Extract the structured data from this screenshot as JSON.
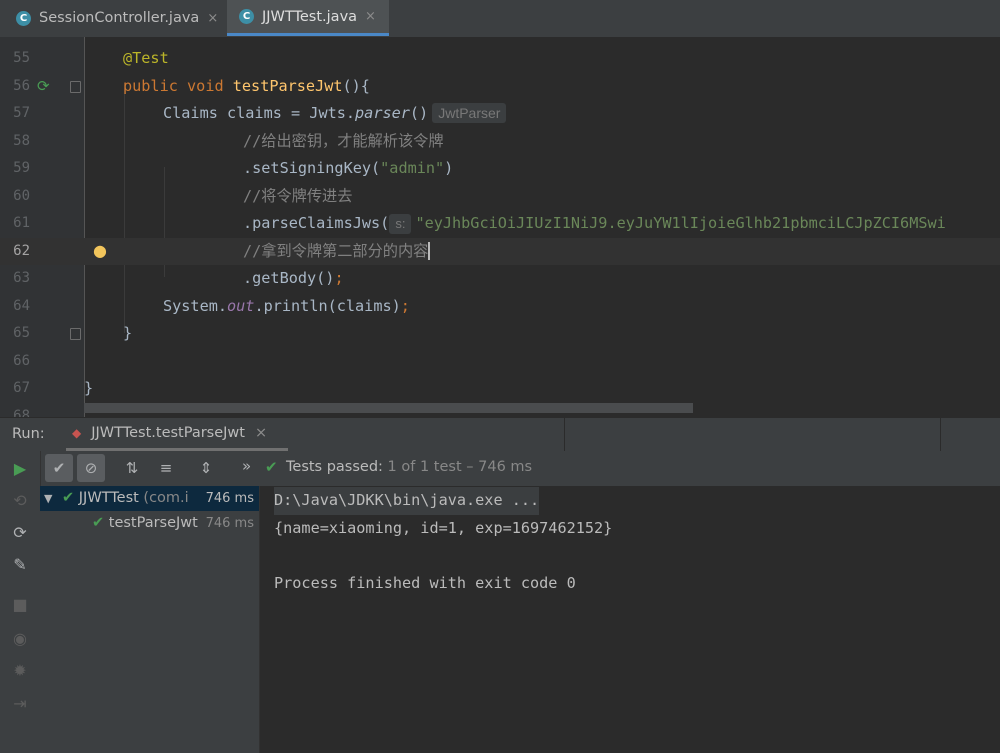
{
  "tabs": [
    {
      "icon": "C",
      "label": "SessionController.java",
      "close": "×"
    },
    {
      "icon": "C",
      "label": "JJWTTest.java",
      "close": "×"
    }
  ],
  "editor": {
    "lines": [
      {
        "num": "55"
      },
      {
        "num": "56"
      },
      {
        "num": "57"
      },
      {
        "num": "58"
      },
      {
        "num": "59"
      },
      {
        "num": "60"
      },
      {
        "num": "61"
      },
      {
        "num": "62"
      },
      {
        "num": "63"
      },
      {
        "num": "64"
      },
      {
        "num": "65"
      },
      {
        "num": "66"
      },
      {
        "num": "67"
      },
      {
        "num": "68"
      }
    ],
    "code": {
      "annotation": "@Test",
      "kw_public": "public",
      "kw_void": "void",
      "method": "testParseJwt",
      "sig_tail": "(){",
      "l57_a": "Claims claims = Jwts.",
      "l57_parser": "parser",
      "l57_b": "()",
      "l57_hint": "JwtParser",
      "l58_comment": "//给出密钥，才能解析该令牌",
      "l59_a": ".setSigningKey(",
      "l59_str": "\"admin\"",
      "l59_b": ")",
      "l60_comment": "//将令牌传进去",
      "l61_a": ".parseClaimsJws(",
      "l61_hint": "s:",
      "l61_str": "\"eyJhbGciOiJIUzI1NiJ9.eyJuYW1lIjoieGlhb21pbmciLCJpZCI6MSwi",
      "l62_comment": "//拿到令牌第二部分的内容",
      "l63_a": ".getBody()",
      "l63_semi": ";",
      "l64_a": "System.",
      "l64_out": "out",
      "l64_b": ".println(claims)",
      "l64_semi": ";",
      "l65": "}",
      "l67": "}"
    }
  },
  "run": {
    "label": "Run:",
    "tab_label": "JJWTTest.testParseJwt",
    "close": "×",
    "status_passed": "Tests passed:",
    "status_detail": "1 of 1 test – 746 ms",
    "more": "»"
  },
  "tree": {
    "root": {
      "name": "JJWTTest",
      "pkg": "(com.i",
      "time": "746 ms"
    },
    "child": {
      "name": "testParseJwt",
      "time": "746 ms"
    }
  },
  "console": {
    "lines": [
      "D:\\Java\\JDKK\\bin\\java.exe ...",
      "{name=xiaoming, id=1, exp=1697462152}",
      "",
      "Process finished with exit code 0"
    ]
  }
}
